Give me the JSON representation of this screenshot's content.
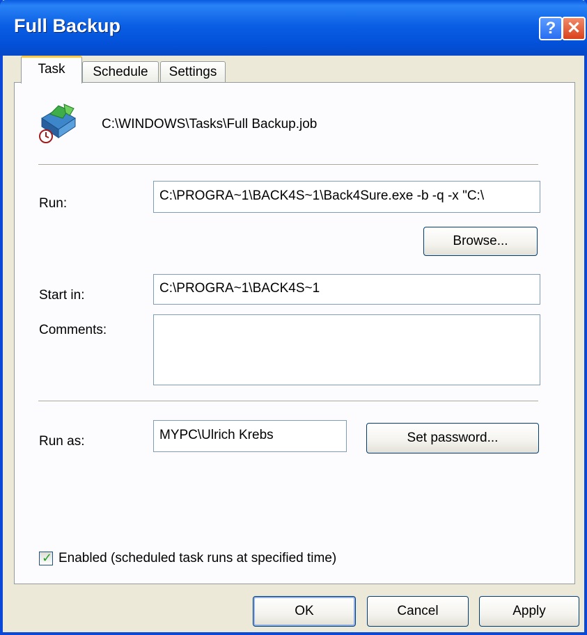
{
  "window": {
    "title": "Full Backup",
    "help_glyph": "?",
    "close_glyph": "✕"
  },
  "tabs": [
    {
      "label": "Task",
      "active": true
    },
    {
      "label": "Schedule",
      "active": false
    },
    {
      "label": "Settings",
      "active": false
    }
  ],
  "task": {
    "icon": "scheduled-task-icon",
    "file_path": "C:\\WINDOWS\\Tasks\\Full Backup.job",
    "run_label": "Run:",
    "run_value": "C:\\PROGRA~1\\BACK4S~1\\Back4Sure.exe -b -q -x \"C:\\",
    "browse_label": "Browse...",
    "start_in_label": "Start in:",
    "start_in_value": "C:\\PROGRA~1\\BACK4S~1",
    "comments_label": "Comments:",
    "comments_value": "",
    "run_as_label": "Run as:",
    "run_as_value": "MYPC\\Ulrich Krebs",
    "set_password_label": "Set password...",
    "enabled_label": "Enabled (scheduled task runs at specified time)",
    "enabled_checked": true
  },
  "footer": {
    "ok_label": "OK",
    "cancel_label": "Cancel",
    "apply_label": "Apply"
  },
  "colors": {
    "titlebar": "#0a5fe4",
    "dialog_bg": "#ece9d8",
    "active_tab_highlight": "#ffc83c"
  }
}
